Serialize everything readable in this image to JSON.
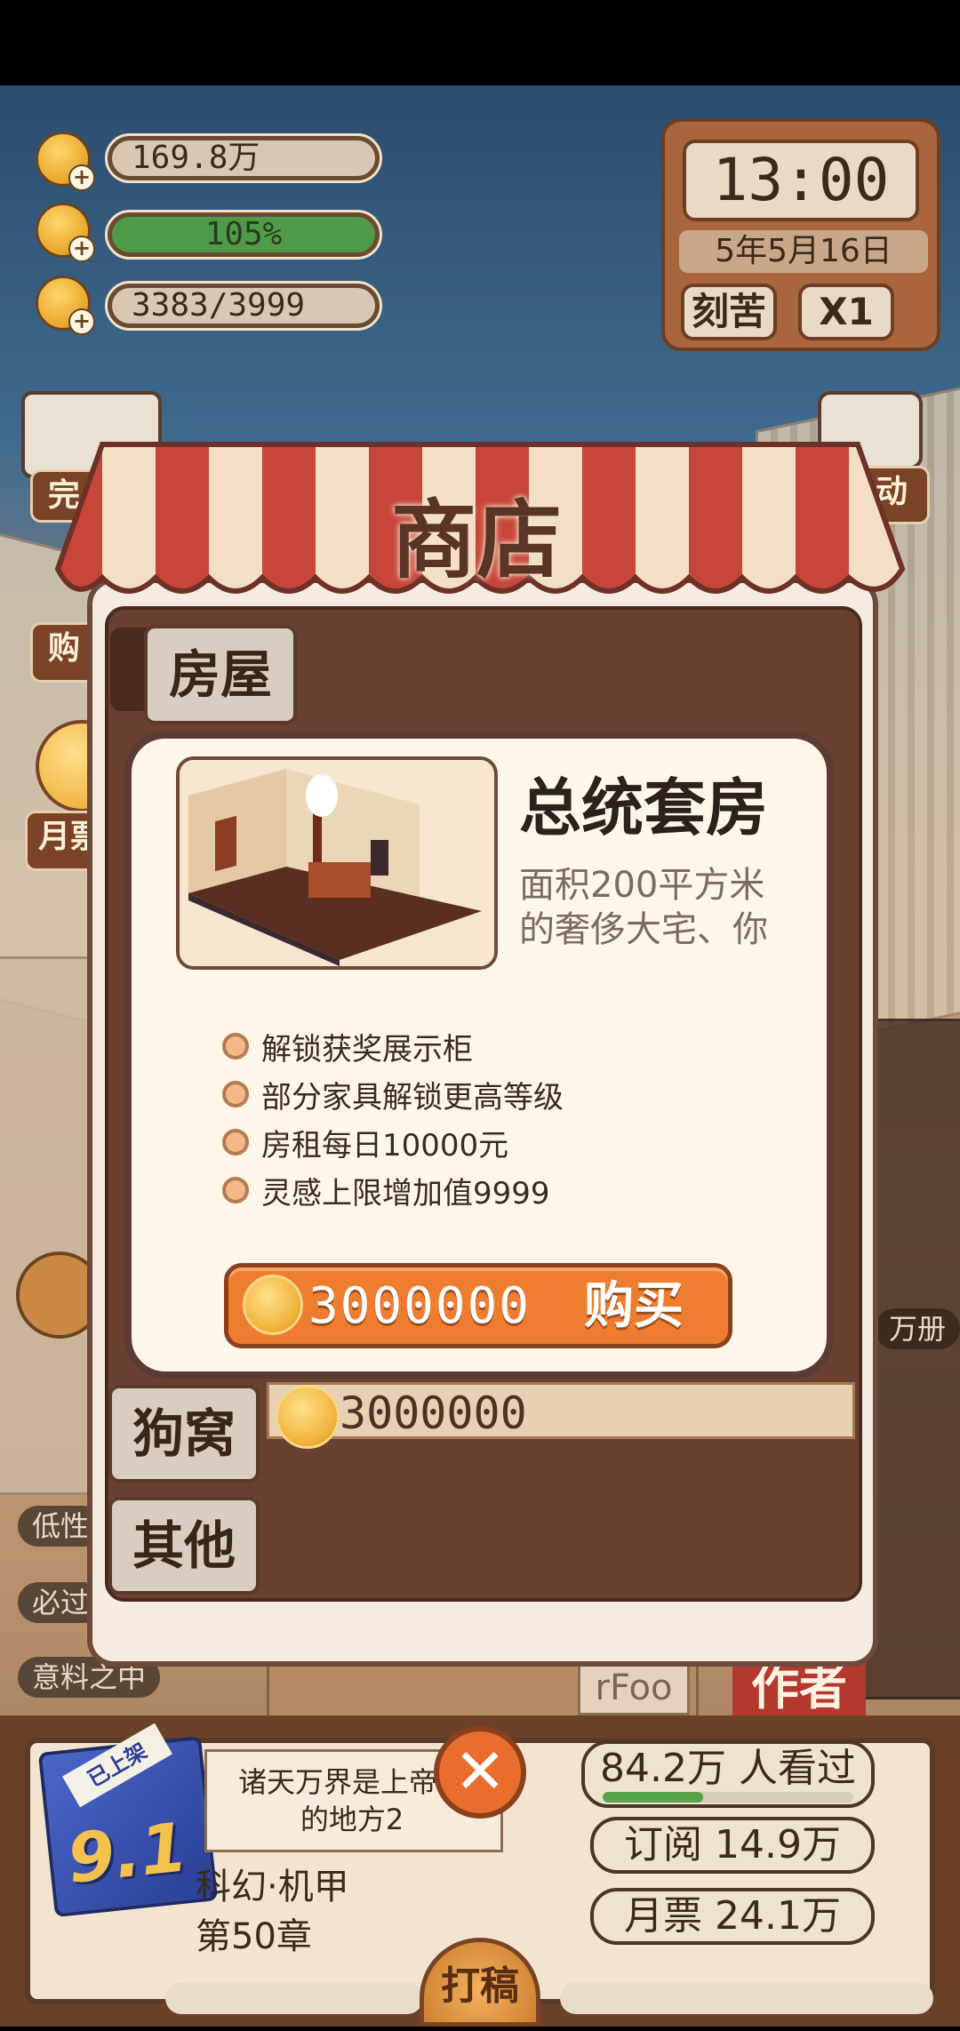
{
  "resources": {
    "coins": "169.8万",
    "energy": "105%",
    "inspiration": "3383/3999"
  },
  "clock": {
    "time": "13:00",
    "date": "5年5月16日",
    "mode_button": "刻苦",
    "speed_button": "X1"
  },
  "background": {
    "left_button_1": "完",
    "left_button_2": "购",
    "left_button_3": "月票",
    "right_button_1": "动",
    "right_label_copies": "万册",
    "tag_1": "低性",
    "tag_2": "必过",
    "tag_3": "意料之中",
    "sign_1": "rFoo",
    "sign_2": "作者"
  },
  "shop": {
    "title": "商店",
    "tabs": [
      "房屋",
      "狗窝",
      "其他"
    ],
    "row_price": "3000000"
  },
  "dialog": {
    "name": "总统套房",
    "description_line_1": "面积200平方米",
    "description_line_2": "的奢侈大宅、你",
    "features": [
      "解锁获奖展示柜",
      "部分家具解锁更高等级",
      "房租每日10000元",
      "灵感上限增加值9999"
    ],
    "price": "3000000",
    "buy_label": "购买"
  },
  "book": {
    "ribbon": "已上架",
    "rating": "9.1",
    "title_line_1": "诸天万界是上帝不",
    "title_line_2": "的地方2",
    "genre": "科幻·机甲",
    "chapter": "第50章",
    "views": "84.2万 人看过",
    "views_progress": 0.4,
    "subscriptions": "订阅 14.9万",
    "monthly_tickets": "月票 24.1万",
    "write_button": "打稿"
  },
  "colors": {
    "accent": "#ef7d2f",
    "frame": "#6e4a3a",
    "awning_red": "#c8453a",
    "awning_cream": "#f2dfc4"
  }
}
